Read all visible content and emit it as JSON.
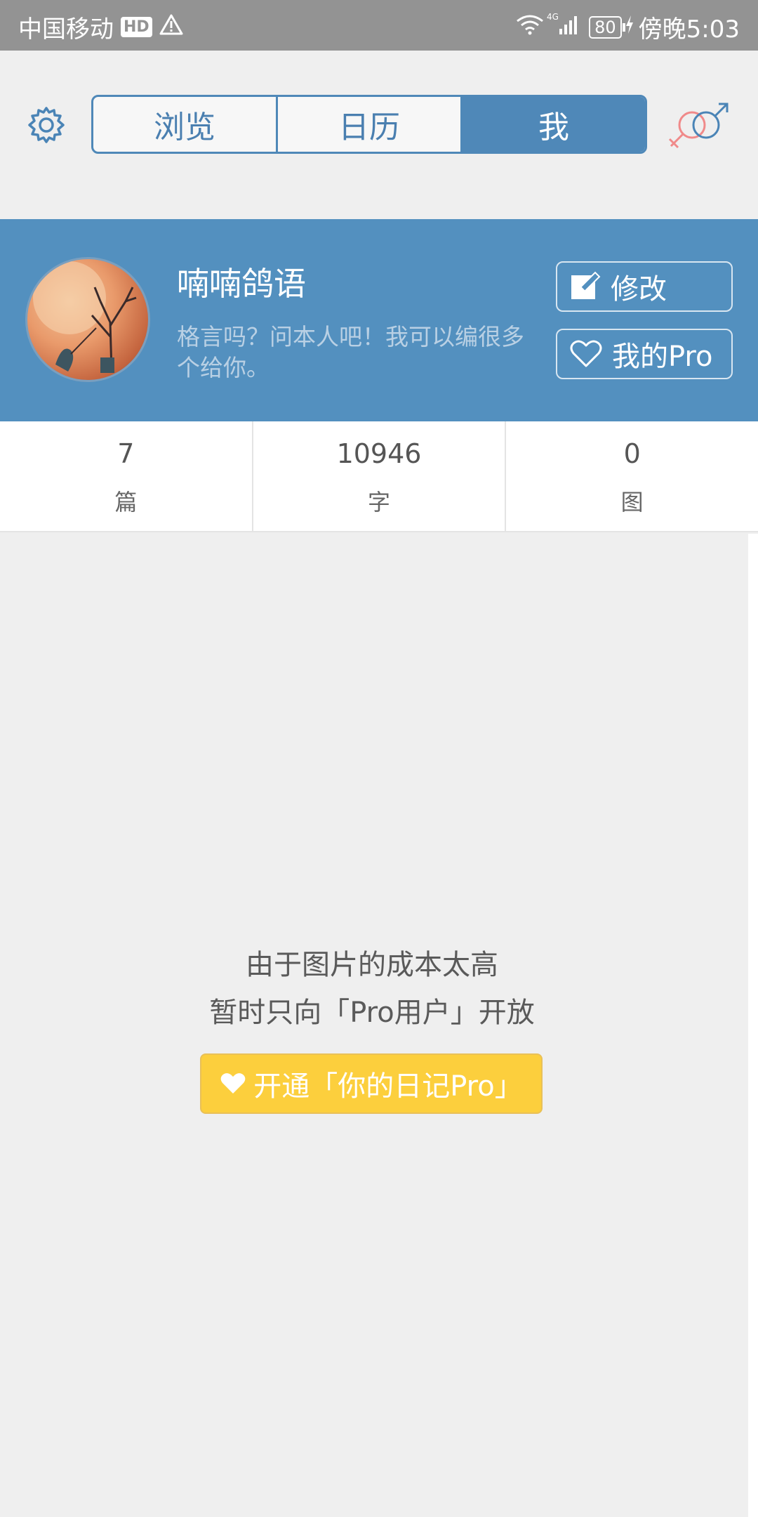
{
  "status_bar": {
    "carrier": "中国移动",
    "hd_badge": "HD",
    "warning_icon": "warning-icon",
    "network": "4G",
    "battery": "80",
    "time": "傍晚5:03"
  },
  "nav": {
    "tabs": [
      {
        "label": "浏览",
        "active": false
      },
      {
        "label": "日历",
        "active": false
      },
      {
        "label": "我",
        "active": true
      }
    ],
    "settings_icon": "gear-icon",
    "gender_icon": "gender-icon"
  },
  "profile": {
    "name": "喃喃鸽语",
    "bio": "格言吗？问本人吧！我可以编很多个给你。",
    "edit_label": "修改",
    "pro_label": "我的Pro"
  },
  "stats": [
    {
      "value": "7",
      "unit": "篇"
    },
    {
      "value": "10946",
      "unit": "字"
    },
    {
      "value": "0",
      "unit": "图"
    }
  ],
  "notice": {
    "line1": "由于图片的成本太高",
    "line2": "暂时只向「Pro用户」开放",
    "button_label": "开通「你的日记Pro」"
  },
  "colors": {
    "accent": "#5390bf",
    "tab_border": "#4f88b8",
    "pro_yellow": "#fccf3d"
  }
}
